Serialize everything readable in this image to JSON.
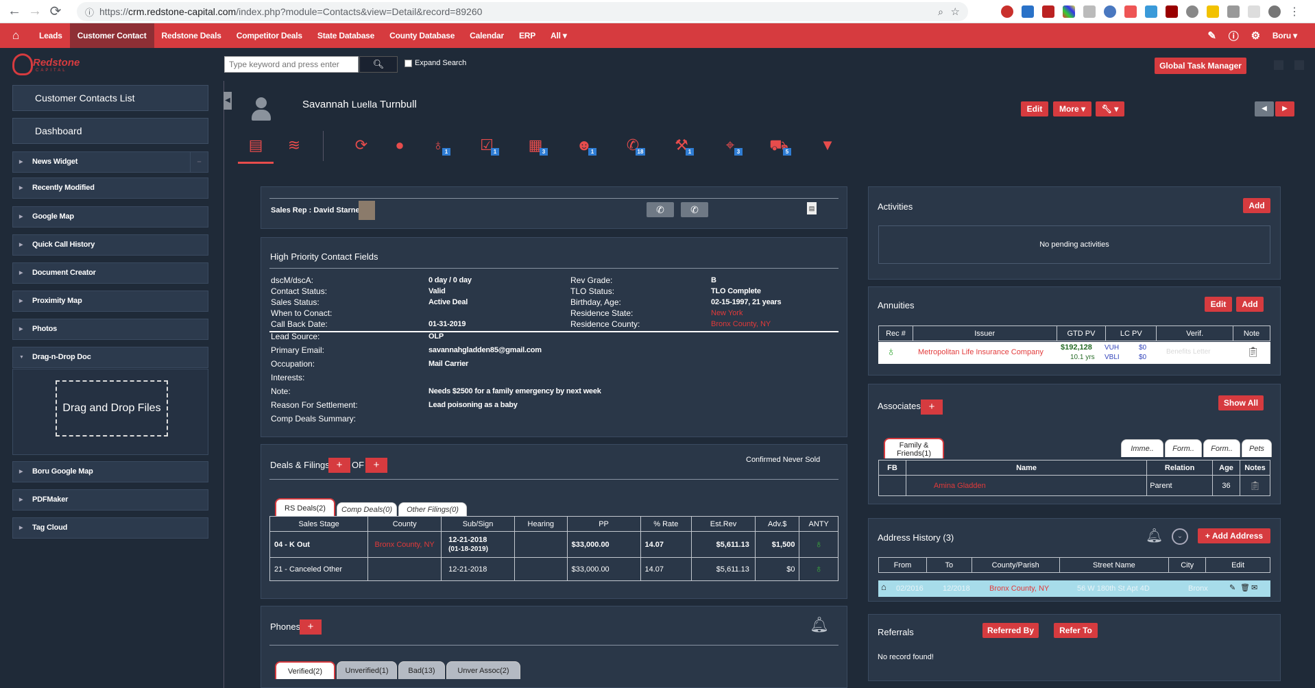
{
  "browser": {
    "url_prefix": "https://",
    "url_host": "crm.redstone-capital.com",
    "url_path": "/index.php?module=Contacts&view=Detail&record=89260"
  },
  "topnav": {
    "items": [
      "Leads",
      "Customer Contact",
      "Redstone Deals",
      "Competitor Deals",
      "State Database",
      "County Database",
      "Calendar",
      "ERP",
      "All ▾"
    ],
    "active_index": 1,
    "user": "Boru ▾"
  },
  "header": {
    "logo_text": "Redstone",
    "logo_sub": "CAPITAL",
    "search_placeholder": "Type keyword and press enter",
    "expand_search": "Expand Search",
    "global_task_manager": "Global Task Manager"
  },
  "sidebar": {
    "customer_contacts_list": "Customer Contacts List",
    "dashboard": "Dashboard",
    "items": [
      "News Widget",
      "Recently Modified",
      "Google Map",
      "Quick Call History",
      "Document Creator",
      "Proximity Map",
      "Photos",
      "Drag-n-Drop Doc",
      "Boru Google Map",
      "PDFMaker",
      "Tag Cloud"
    ],
    "drag_drop_label": "Drag and Drop Files"
  },
  "contact": {
    "first": "Savannah",
    "middle": "Luella",
    "last": "Turnbull",
    "edit": "Edit",
    "more": "More ▾",
    "tools": "▾"
  },
  "iconbar": {
    "badges": [
      "1",
      "1",
      "3",
      "1",
      "18",
      "1",
      "3",
      "5"
    ]
  },
  "sales_rep": {
    "label": "Sales Rep : David Starner"
  },
  "high_priority": {
    "title": "High Priority Contact Fields",
    "left": [
      {
        "k": "dscM/dscA:",
        "v": "0 day / 0 day"
      },
      {
        "k": "Contact Status:",
        "v": "Valid"
      },
      {
        "k": "Sales Status:",
        "v": "Active Deal"
      },
      {
        "k": "When to Conact:",
        "v": ""
      },
      {
        "k": "Call Back Date:",
        "v": "01-31-2019"
      }
    ],
    "right": [
      {
        "k": "Rev Grade:",
        "v": "B"
      },
      {
        "k": "TLO Status:",
        "v": "TLO Complete"
      },
      {
        "k": "Birthday, Age:",
        "v": "02-15-1997, 21 years"
      },
      {
        "k": "Residence State:",
        "v": "New York"
      },
      {
        "k": "Residence County:",
        "v": "Bronx County, NY"
      }
    ],
    "bottom": [
      {
        "k": "Lead Source:",
        "v": "OLP"
      },
      {
        "k": "Primary Email:",
        "v": "savannahgladden85@gmail.com"
      },
      {
        "k": "Occupation:",
        "v": "Mail Carrier"
      },
      {
        "k": "Interests:",
        "v": ""
      },
      {
        "k": "Note:",
        "v": "Needs $2500 for a family emergency by next week"
      },
      {
        "k": "Reason For Settlement:",
        "v": "Lead poisoning as a baby"
      },
      {
        "k": "Comp Deals Summary:",
        "v": ""
      }
    ]
  },
  "deals": {
    "title": "Deals & Filings",
    "of": "OF",
    "confirmed": "Confirmed Never Sold",
    "tabs": [
      "RS Deals(2)",
      "Comp Deals(0)",
      "Other Filings(0)"
    ],
    "headers": [
      "Sales Stage",
      "County",
      "Sub/Sign",
      "Hearing",
      "PP",
      "% Rate",
      "Est.Rev",
      "Adv.$",
      "ANTY"
    ],
    "rows": [
      {
        "stage": "04 - K Out",
        "county": "Bronx County, NY",
        "sub": "12-21-2018",
        "sub2": "(01-18-2019)",
        "hearing": "",
        "pp": "$33,000.00",
        "rate": "14.07",
        "est": "$5,611.13",
        "adv": "$1,500"
      },
      {
        "stage": "21 - Canceled Other",
        "county": "",
        "sub": "12-21-2018",
        "sub2": "",
        "hearing": "",
        "pp": "$33,000.00",
        "rate": "14.07",
        "est": "$5,611.13",
        "adv": "$0"
      }
    ]
  },
  "phones": {
    "title": "Phones",
    "tabs": [
      "Verified(2)",
      "Unverified(1)",
      "Bad(13)",
      "Unver Assoc(2)"
    ]
  },
  "activities": {
    "title": "Activities",
    "add": "Add",
    "empty": "No pending activities"
  },
  "annuities": {
    "title": "Annuities",
    "edit": "Edit",
    "add": "Add",
    "headers": [
      "Rec #",
      "Issuer",
      "GTD PV",
      "LC PV",
      "Verif.",
      "Note"
    ],
    "row": {
      "issuer": "Metropolitan Life Insurance Company",
      "gtd": "$192,128",
      "gtd_yrs": "10.1 yrs",
      "lc1": "VUH",
      "lc2": "VBLI",
      "lc1v": "$0",
      "lc2v": "$0",
      "verif": "Benefits Letter"
    }
  },
  "associates": {
    "title": "Associates",
    "show_all": "Show All",
    "tabs": [
      "Family & Friends(1)",
      "Imme..",
      "Form..",
      "Form..",
      "Pets"
    ],
    "headers": [
      "FB",
      "Name",
      "Relation",
      "Age",
      "Notes"
    ],
    "row": {
      "name": "Amina Gladden",
      "relation": "Parent",
      "age": "36"
    }
  },
  "address": {
    "title": "Address History (3)",
    "add": "+ Add Address",
    "headers": [
      "From",
      "To",
      "County/Parish",
      "Street Name",
      "City",
      "Edit"
    ],
    "row": {
      "from": "02/2016",
      "to": "12/2018",
      "county": "Bronx County, NY",
      "street": "56 W 180th St Apt 4D",
      "city": "Bronx"
    }
  },
  "referrals": {
    "title": "Referrals",
    "referred_by": "Referred By",
    "refer_to": "Refer To",
    "empty": "No record found!"
  }
}
